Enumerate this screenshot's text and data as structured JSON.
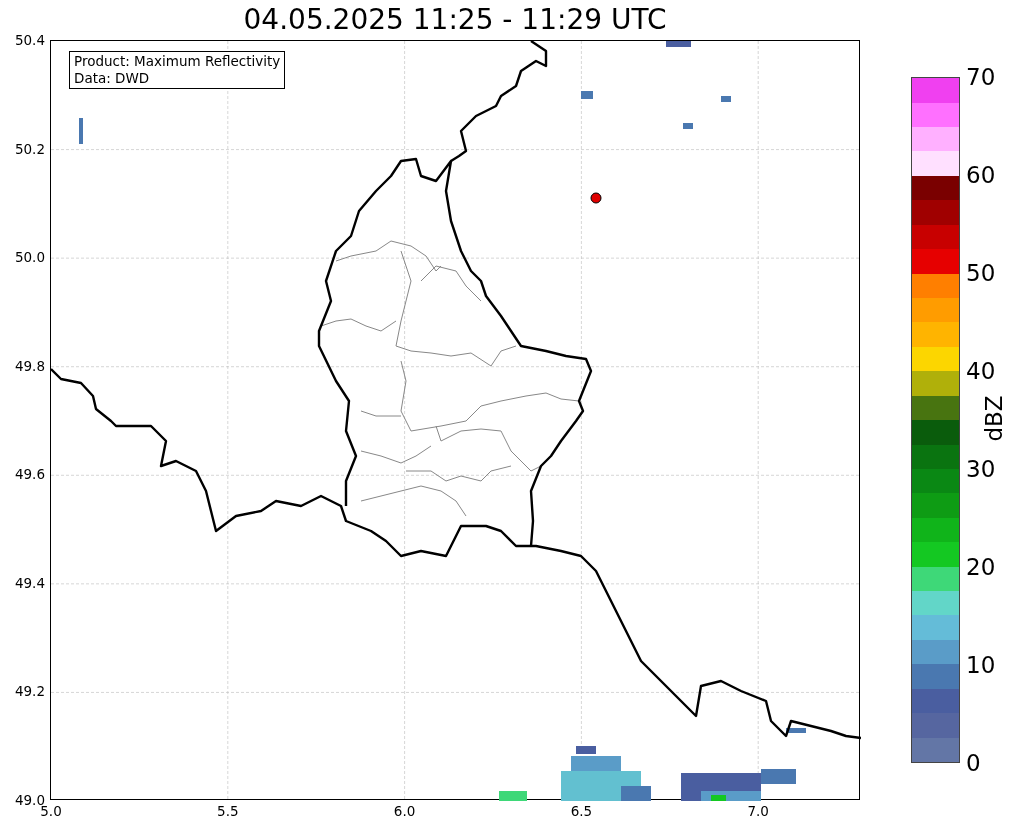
{
  "title": "04.05.2025 11:25 - 11:29 UTC",
  "annotation": [
    "Product: Maximum Reflectivity",
    "Data: DWD"
  ],
  "x_ticks": [
    "5.0",
    "5.5",
    "6.0",
    "6.5",
    "7.0"
  ],
  "y_ticks": [
    "50.4",
    "50.2",
    "50.0",
    "49.8",
    "49.6",
    "49.4",
    "49.2",
    "49.0"
  ],
  "colorbar": {
    "label": "dBZ",
    "ticks": [
      "70",
      "60",
      "50",
      "40",
      "30",
      "20",
      "10",
      "0"
    ],
    "segments": [
      {
        "color": "#6376a6"
      },
      {
        "color": "#5666a0"
      },
      {
        "color": "#4a5ea0"
      },
      {
        "color": "#4a78b0"
      },
      {
        "color": "#5a9cc8"
      },
      {
        "color": "#64bcd8"
      },
      {
        "color": "#62d6c8"
      },
      {
        "color": "#3ed878"
      },
      {
        "color": "#14c822"
      },
      {
        "color": "#10b41a"
      },
      {
        "color": "#0e9c14"
      },
      {
        "color": "#0a8814"
      },
      {
        "color": "#0a7410"
      },
      {
        "color": "#0a5c0c"
      },
      {
        "color": "#487410"
      },
      {
        "color": "#b0b00a"
      },
      {
        "color": "#fcd600"
      },
      {
        "color": "#ffb400"
      },
      {
        "color": "#ff9c00"
      },
      {
        "color": "#ff7f00"
      },
      {
        "color": "#e60000"
      },
      {
        "color": "#c80000"
      },
      {
        "color": "#a00000"
      },
      {
        "color": "#7a0000"
      },
      {
        "color": "#ffe0ff"
      },
      {
        "color": "#ffb0ff"
      },
      {
        "color": "#ff70ff"
      },
      {
        "color": "#f040f0"
      }
    ]
  }
}
